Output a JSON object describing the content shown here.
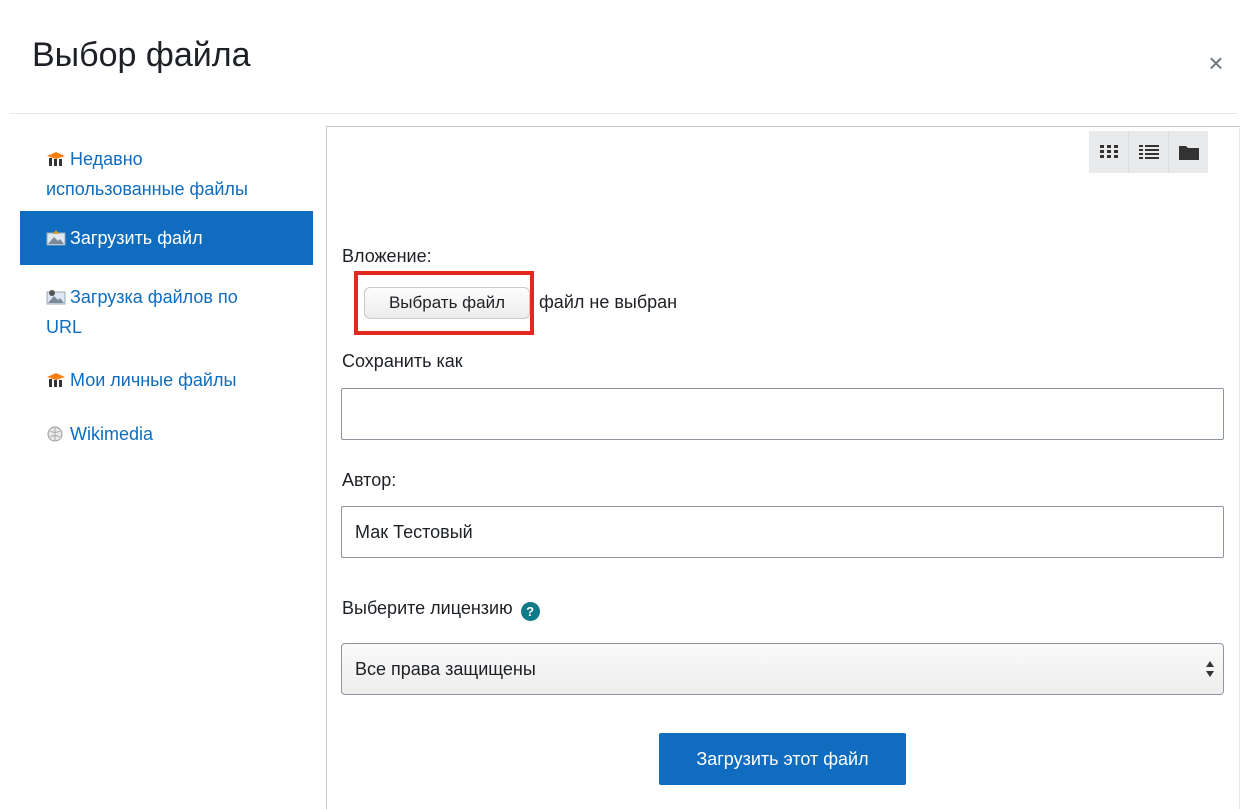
{
  "dialog": {
    "title": "Выбор файла",
    "close_label": "×"
  },
  "sidebar": {
    "items": [
      {
        "label_line1": "Недавно",
        "label_line2": "использованные файлы",
        "icon": "moodle-hat-icon",
        "active": false
      },
      {
        "label_line1": "Загрузить файл",
        "icon": "upload-picture-icon",
        "active": true
      },
      {
        "label_line1": "Загрузка файлов по",
        "label_line2": "URL",
        "icon": "url-download-icon",
        "active": false
      },
      {
        "label_line1": "Мои личные файлы",
        "icon": "moodle-hat-icon",
        "active": false
      },
      {
        "label_line1": "Wikimedia",
        "icon": "wikimedia-globe-icon",
        "active": false
      }
    ]
  },
  "toolbar": {
    "views": [
      "grid-view-icon",
      "list-view-icon",
      "folder-view-icon"
    ]
  },
  "form": {
    "attachment_label": "Вложение:",
    "choose_file_label": "Выбрать файл",
    "no_file_text": "файл не выбран",
    "save_as_label": "Сохранить как",
    "save_as_value": "",
    "author_label": "Автор:",
    "author_value": "Мак Тестовый",
    "license_label": "Выберите лицензию",
    "help_icon": "?",
    "license_value": "Все права защищены",
    "upload_button_label": "Загрузить этот файл"
  },
  "colors": {
    "accent": "#0f6cbf",
    "highlight_border": "#e3281f",
    "help_icon": "#0f7a8a"
  }
}
